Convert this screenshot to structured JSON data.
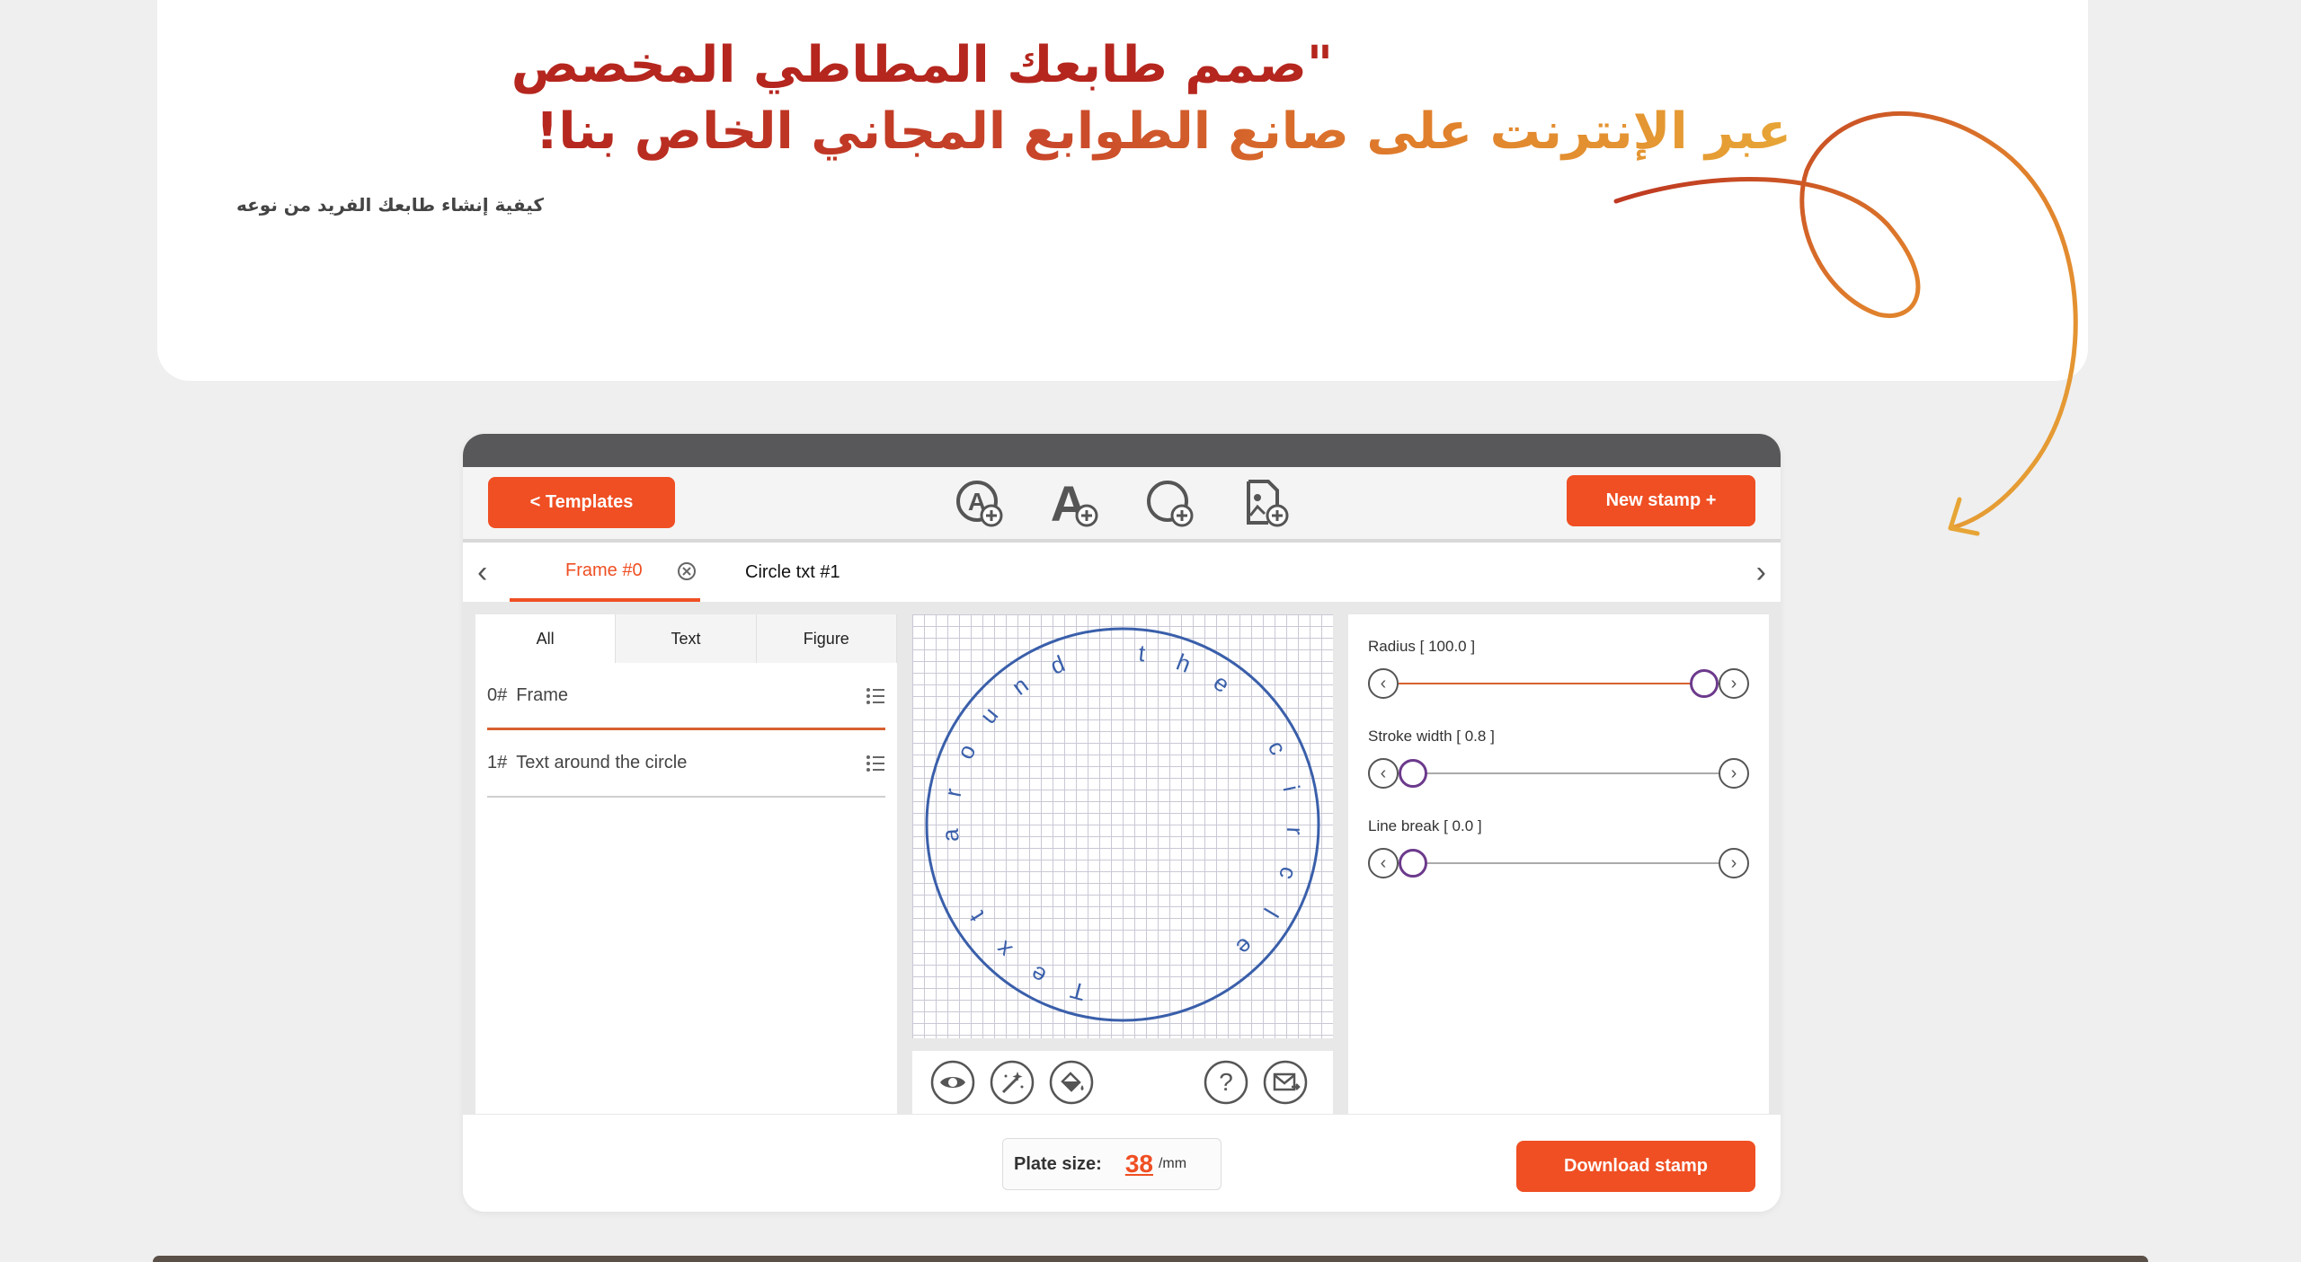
{
  "hero": {
    "title_line1": "\"صمم طابعك المطاطي المخصص",
    "title_line2": "عبر الإنترنت على صانع الطوابع المجاني الخاص بنا!",
    "subtitle": "كيفية إنشاء طابعك الفريد من نوعه"
  },
  "toolbar": {
    "templates_label": "<  Templates",
    "new_stamp_label": "New stamp +",
    "icons": [
      "circle-text-add-icon",
      "text-add-icon",
      "figure-add-icon",
      "image-add-icon"
    ]
  },
  "tabs": {
    "frame_tab": "Frame #0",
    "circle_tab": "Circle txt #1"
  },
  "filters": [
    "All",
    "Text",
    "Figure"
  ],
  "layers": [
    {
      "num": "0#",
      "name": "Frame"
    },
    {
      "num": "1#",
      "name": "Text around the circle"
    }
  ],
  "stamp": {
    "circle_text": "Text around the circle",
    "color": "#3a5faa"
  },
  "sliders": [
    {
      "label": "Radius [ 100.0 ]",
      "value": 1.0
    },
    {
      "label": "Stroke width [ 0.8 ]",
      "value": 0.0
    },
    {
      "label": "Line break [ 0.0 ]",
      "value": 0.0
    }
  ],
  "bottom": {
    "plate_label": "Plate size:",
    "plate_value": "38",
    "plate_unit": "/mm",
    "download_label": "Download stamp"
  },
  "colors": {
    "accent": "#ef4f23",
    "hero_red": "#b5261e",
    "hero_gold": "#e7a536"
  }
}
